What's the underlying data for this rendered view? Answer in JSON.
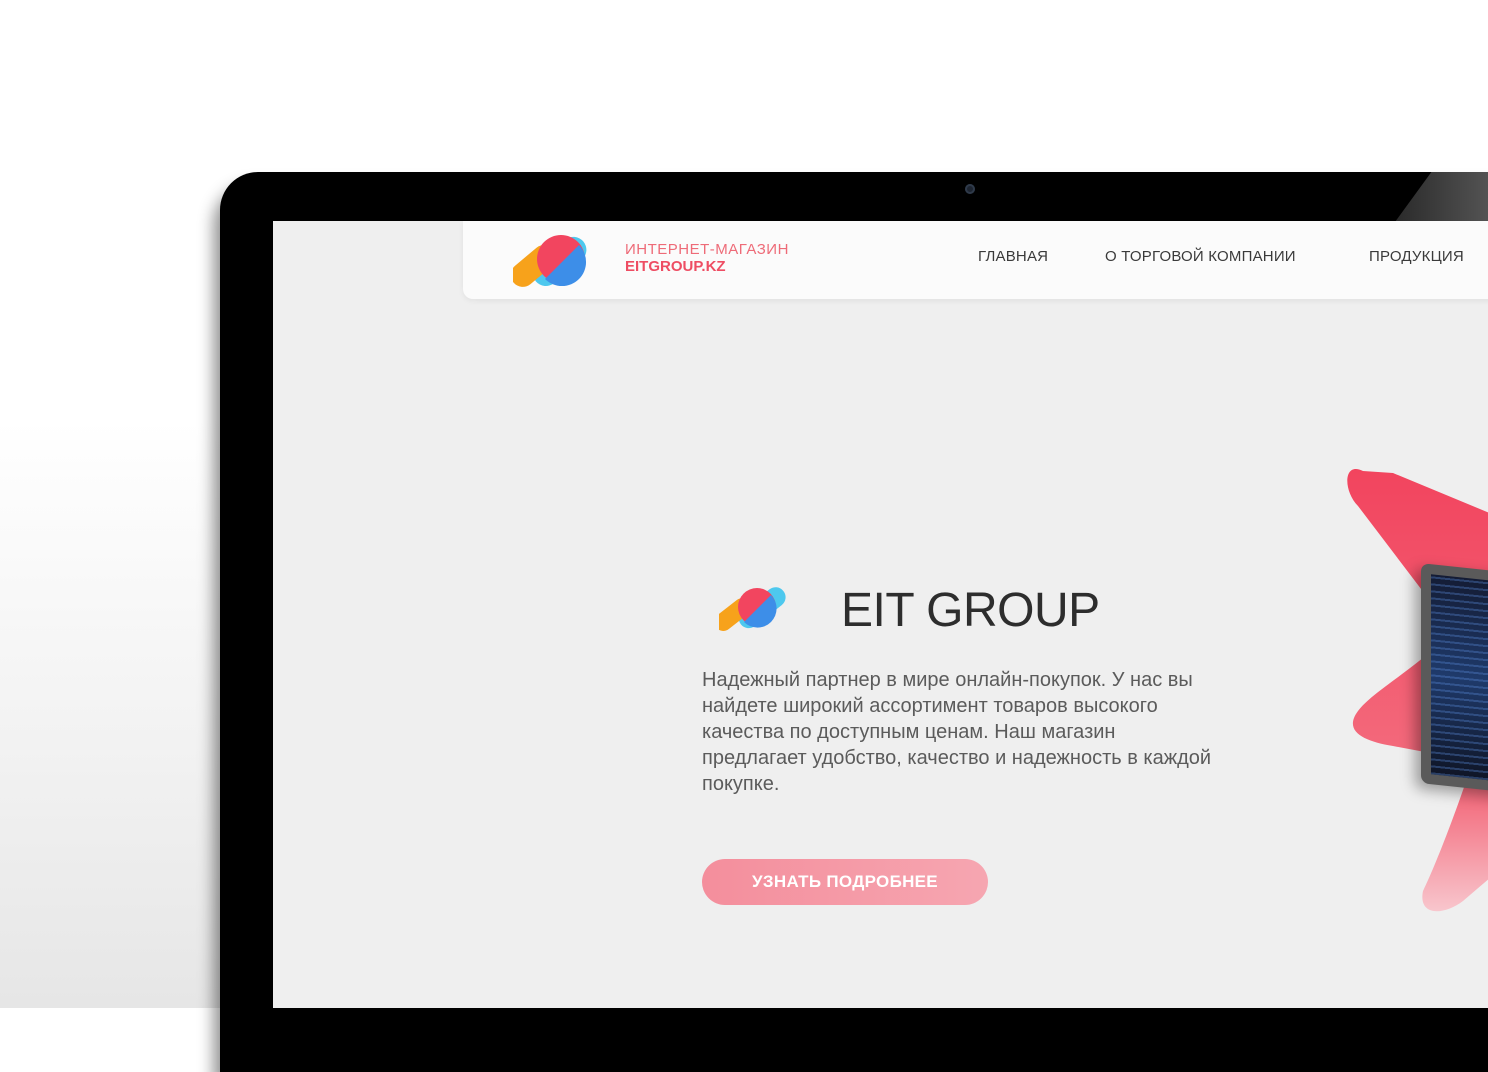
{
  "colors": {
    "accent": "#ee4d63",
    "accent_light": "#f48e9c",
    "logo_orange": "#f7a21b",
    "logo_blue": "#3d8ee8",
    "logo_cyan": "#4dc8ee"
  },
  "header": {
    "logo_line1": "ИНТЕРНЕТ-МАГАЗИН",
    "logo_line2": "EITGROUP.KZ",
    "nav": [
      "ГЛАВНАЯ",
      "О ТОРГОВОЙ КОМПАНИИ",
      "ПРОДУКЦИЯ"
    ]
  },
  "hero": {
    "title": "EIT GROUP",
    "description": "Надежный партнер в мире онлайн-покупок. У нас вы найдете широкий ассортимент товаров высокого качества по доступным ценам. Наш магазин предлагает удобство, качество и надежность в каждой покупке.",
    "button_label": "УЗНАТЬ ПОДРОБНЕЕ"
  }
}
